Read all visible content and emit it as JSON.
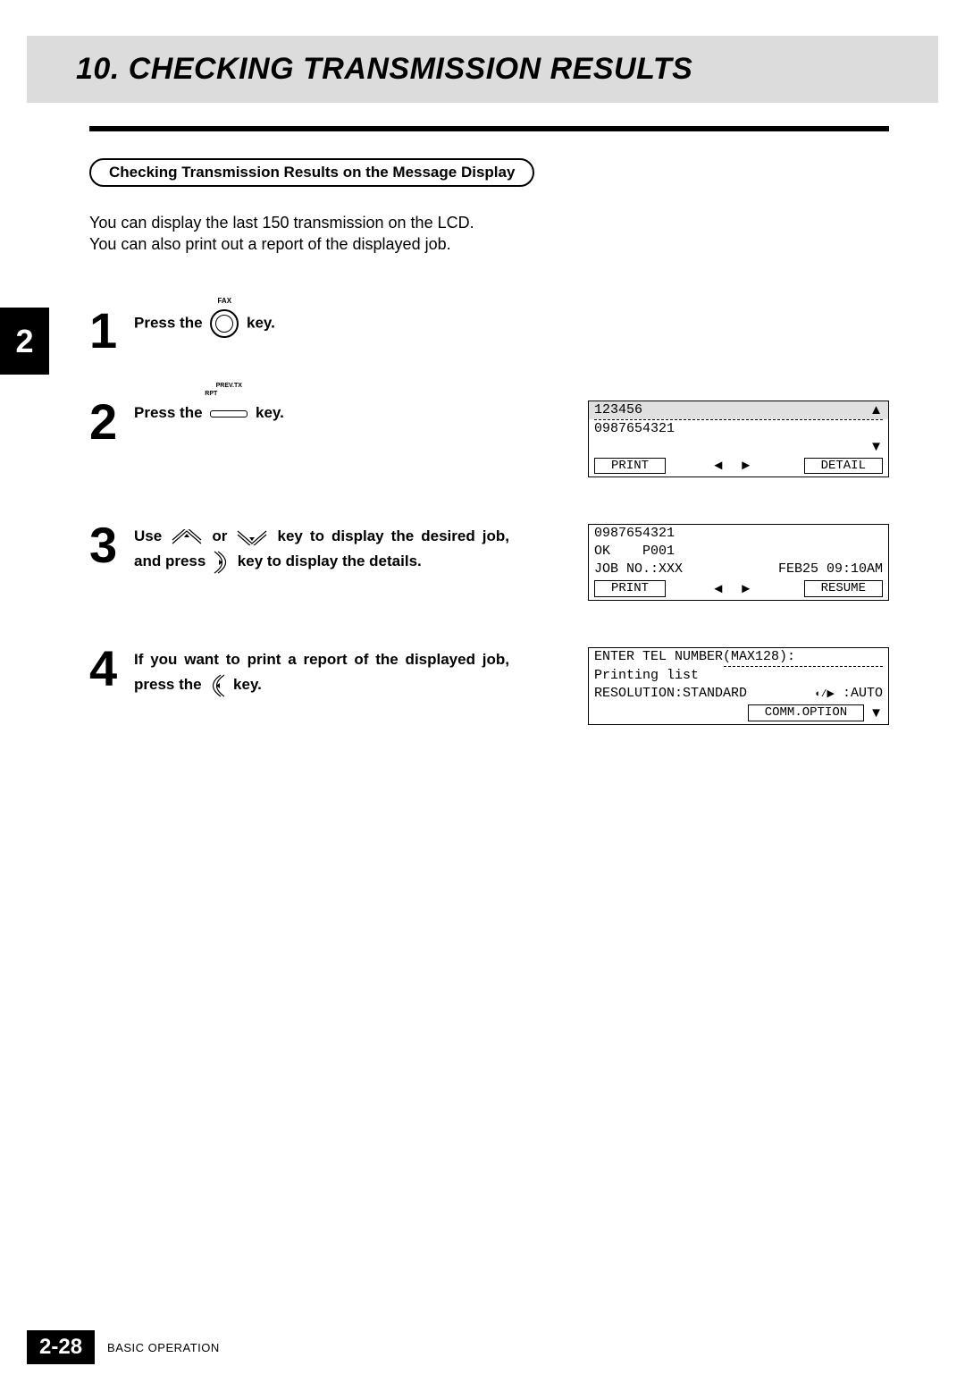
{
  "title": "10. CHECKING TRANSMISSION RESULTS",
  "side_tab": "2",
  "subheading": "Checking Transmission Results on the Message Display",
  "intro_line1": "You can display the last 150 transmission on the LCD.",
  "intro_line2": "You can also print out a report of the displayed job.",
  "steps": {
    "s1": {
      "num": "1",
      "pre": "Press the ",
      "post": " key.",
      "fax_label": "FAX"
    },
    "s2": {
      "num": "2",
      "pre": "Press the ",
      "post": " key.",
      "rect_label1": "PREV.TX",
      "rect_label2": "RPT"
    },
    "s3": {
      "num": "3",
      "pre": "Use ",
      "mid1": " or ",
      "mid2": " key to display the desired job, and press ",
      "post": " key to display the details."
    },
    "s4": {
      "num": "4",
      "pre": "If you want to print a report of the displayed job, press the ",
      "post": " key."
    }
  },
  "lcd1": {
    "row1_left": "123456",
    "row2_left": "0987654321",
    "soft_left": "PRINT",
    "soft_right": "DETAIL",
    "up": "▲",
    "down": "▼",
    "arrows": "◄  ►"
  },
  "lcd2": {
    "row1": "0987654321",
    "row2_left": "OK",
    "row2_right": "P001",
    "row3_left": "JOB NO.:XXX",
    "row3_right": "FEB25 09:10AM",
    "soft_left": "PRINT",
    "soft_right": "RESUME",
    "arrows": "◄  ►"
  },
  "lcd3": {
    "row1": "ENTER TEL NUMBER(MAX128):",
    "row2": "Printing list",
    "row3_left": "RESOLUTION:STANDARD",
    "row3_right": " :AUTO",
    "small_icon": "◐/▶",
    "soft_right": "COMM.OPTION",
    "down": "▼"
  },
  "footer": {
    "page": "2-28",
    "label": "BASIC OPERATION"
  }
}
